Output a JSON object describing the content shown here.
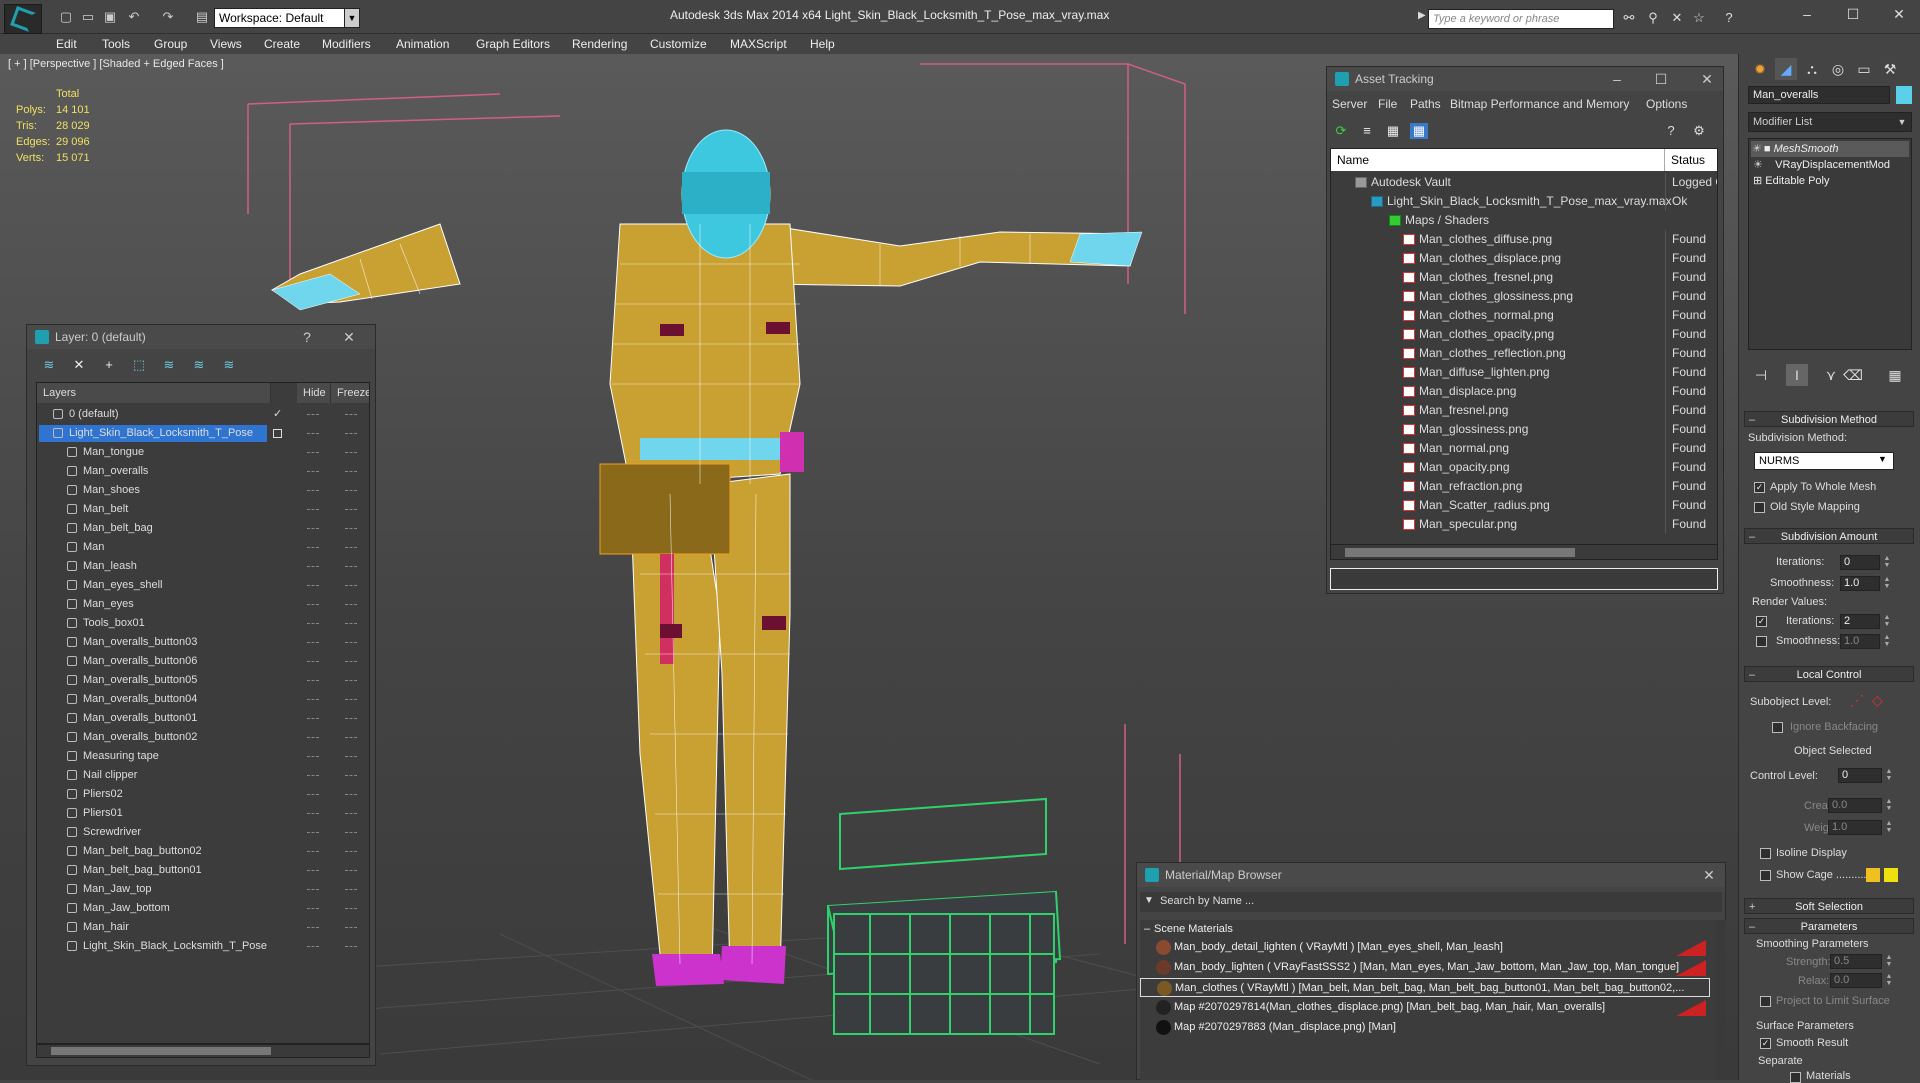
{
  "app": {
    "title": "Autodesk 3ds Max  2014 x64      Light_Skin_Black_Locksmith_T_Pose_max_vray.max",
    "workspace": "Workspace: Default",
    "search_placeholder": "Type a keyword or phrase"
  },
  "menu": [
    "Edit",
    "Tools",
    "Group",
    "Views",
    "Create",
    "Modifiers",
    "Animation",
    "Graph Editors",
    "Rendering",
    "Customize",
    "MAXScript",
    "Help"
  ],
  "viewport": {
    "label": "[ + ] [Perspective ] [Shaded + Edged Faces ]",
    "stats": {
      "header": "Total",
      "polys_label": "Polys:",
      "polys": "14 101",
      "tris_label": "Tris:",
      "tris": "28 029",
      "edges_label": "Edges:",
      "edges": "29 096",
      "verts_label": "Verts:",
      "verts": "15 071"
    }
  },
  "layers": {
    "title": "Layer: 0 (default)",
    "help": "?",
    "col_layers": "Layers",
    "col_hide": "Hide",
    "col_freeze": "Freeze",
    "rows": [
      {
        "name": "0 (default)",
        "level": 1,
        "checked": true
      },
      {
        "name": "Light_Skin_Black_Locksmith_T_Pose",
        "level": 1,
        "selected": true
      },
      {
        "name": "Man_tongue",
        "level": 2
      },
      {
        "name": "Man_overalls",
        "level": 2
      },
      {
        "name": "Man_shoes",
        "level": 2
      },
      {
        "name": "Man_belt",
        "level": 2
      },
      {
        "name": "Man_belt_bag",
        "level": 2
      },
      {
        "name": "Man",
        "level": 2
      },
      {
        "name": "Man_leash",
        "level": 2
      },
      {
        "name": "Man_eyes_shell",
        "level": 2
      },
      {
        "name": "Man_eyes",
        "level": 2
      },
      {
        "name": "Tools_box01",
        "level": 2
      },
      {
        "name": "Man_overalls_button03",
        "level": 2
      },
      {
        "name": "Man_overalls_button06",
        "level": 2
      },
      {
        "name": "Man_overalls_button05",
        "level": 2
      },
      {
        "name": "Man_overalls_button04",
        "level": 2
      },
      {
        "name": "Man_overalls_button01",
        "level": 2
      },
      {
        "name": "Man_overalls_button02",
        "level": 2
      },
      {
        "name": "Measuring tape",
        "level": 2
      },
      {
        "name": "Nail clipper",
        "level": 2
      },
      {
        "name": "Pliers02",
        "level": 2
      },
      {
        "name": "Pliers01",
        "level": 2
      },
      {
        "name": "Screwdriver",
        "level": 2
      },
      {
        "name": "Man_belt_bag_button02",
        "level": 2
      },
      {
        "name": "Man_belt_bag_button01",
        "level": 2
      },
      {
        "name": "Man_Jaw_top",
        "level": 2
      },
      {
        "name": "Man_Jaw_bottom",
        "level": 2
      },
      {
        "name": "Man_hair",
        "level": 2
      },
      {
        "name": "Light_Skin_Black_Locksmith_T_Pose",
        "level": 2
      }
    ]
  },
  "asset_tracking": {
    "title": "Asset Tracking",
    "menu": [
      "Server",
      "File",
      "Paths",
      "Bitmap Performance and Memory",
      "Options"
    ],
    "col_name": "Name",
    "col_status": "Status",
    "rows": [
      {
        "name": "Autodesk Vault",
        "status": "Logged O",
        "level": 0,
        "icon": "vault"
      },
      {
        "name": "Light_Skin_Black_Locksmith_T_Pose_max_vray.max",
        "status": "Ok",
        "level": 1,
        "icon": "max"
      },
      {
        "name": "Maps / Shaders",
        "status": "",
        "level": 2,
        "icon": "maps"
      },
      {
        "name": "Man_clothes_diffuse.png",
        "status": "Found",
        "level": 3,
        "icon": "png"
      },
      {
        "name": "Man_clothes_displace.png",
        "status": "Found",
        "level": 3,
        "icon": "png"
      },
      {
        "name": "Man_clothes_fresnel.png",
        "status": "Found",
        "level": 3,
        "icon": "png"
      },
      {
        "name": "Man_clothes_glossiness.png",
        "status": "Found",
        "level": 3,
        "icon": "png"
      },
      {
        "name": "Man_clothes_normal.png",
        "status": "Found",
        "level": 3,
        "icon": "png"
      },
      {
        "name": "Man_clothes_opacity.png",
        "status": "Found",
        "level": 3,
        "icon": "png"
      },
      {
        "name": "Man_clothes_reflection.png",
        "status": "Found",
        "level": 3,
        "icon": "png"
      },
      {
        "name": "Man_diffuse_lighten.png",
        "status": "Found",
        "level": 3,
        "icon": "png"
      },
      {
        "name": "Man_displace.png",
        "status": "Found",
        "level": 3,
        "icon": "png"
      },
      {
        "name": "Man_fresnel.png",
        "status": "Found",
        "level": 3,
        "icon": "png"
      },
      {
        "name": "Man_glossiness.png",
        "status": "Found",
        "level": 3,
        "icon": "png"
      },
      {
        "name": "Man_normal.png",
        "status": "Found",
        "level": 3,
        "icon": "png"
      },
      {
        "name": "Man_opacity.png",
        "status": "Found",
        "level": 3,
        "icon": "png"
      },
      {
        "name": "Man_refraction.png",
        "status": "Found",
        "level": 3,
        "icon": "png"
      },
      {
        "name": "Man_Scatter_radius.png",
        "status": "Found",
        "level": 3,
        "icon": "png"
      },
      {
        "name": "Man_specular.png",
        "status": "Found",
        "level": 3,
        "icon": "png"
      }
    ]
  },
  "material_browser": {
    "title": "Material/Map Browser",
    "search_placeholder": "Search by Name ...",
    "group": "Scene Materials",
    "rows": [
      {
        "text": "Man_body_detail_lighten  ( VRayMtl ) [Man_eyes_shell, Man_leash]",
        "thumb": "#8a4a30",
        "flag": true
      },
      {
        "text": "Man_body_lighten  ( VRayFastSSS2 ) [Man, Man_eyes, Man_Jaw_bottom, Man_Jaw_top, Man_tongue]",
        "thumb": "#6b3a2a",
        "flag": true
      },
      {
        "text": "Man_clothes  ( VRayMtl ) [Man_belt, Man_belt_bag, Man_belt_bag_button01, Man_belt_bag_button02,...",
        "thumb": "#7a5a20",
        "flag": false,
        "selected": true
      },
      {
        "text": "Map #2070297814(Man_clothes_displace.png)  [Man_belt_bag, Man_hair, Man_overalls]",
        "thumb": "#222222",
        "flag": true
      },
      {
        "text": "Map #2070297883 (Man_displace.png)  [Man]",
        "thumb": "#111111",
        "flag": false
      }
    ]
  },
  "command_panel": {
    "object_name": "Man_overalls",
    "object_color": "#5ad0ea",
    "modifier_list": "Modifier List",
    "stack": [
      "MeshSmooth",
      "VRayDisplacementMod",
      "Editable Poly"
    ],
    "subdiv_method_hdr": "Subdivision Method",
    "subdiv_method_label": "Subdivision Method:",
    "subdiv_method_value": "NURMS",
    "apply_whole_mesh": "Apply To Whole Mesh",
    "old_style_mapping": "Old Style Mapping",
    "subdiv_amount_hdr": "Subdivision Amount",
    "iterations_label": "Iterations:",
    "iterations": "0",
    "smoothness_label": "Smoothness:",
    "smoothness": "1.0",
    "render_values": "Render Values:",
    "r_iterations_label": "Iterations:",
    "r_iterations": "2",
    "r_smoothness_label": "Smoothness:",
    "r_smoothness": "1.0",
    "local_control_hdr": "Local Control",
    "subobject_level": "Subobject Level:",
    "ignore_backfacing": "Ignore Backfacing",
    "object_selected": "Object Selected",
    "control_level_label": "Control Level:",
    "control_level": "0",
    "crease_label": "Crease:",
    "crease": "0.0",
    "weight_label": "Weight:",
    "weight": "1.0",
    "isoline_display": "Isoline Display",
    "show_cage": "Show Cage ..........",
    "soft_selection_hdr": "Soft Selection",
    "parameters_hdr": "Parameters",
    "smoothing_params": "Smoothing Parameters",
    "strength_label": "Strength:",
    "strength": "0.5",
    "relax_label": "Relax:",
    "relax": "0.0",
    "project_limit": "Project to Limit Surface",
    "surface_params": "Surface Parameters",
    "smooth_result": "Smooth Result",
    "separate": "Separate",
    "materials": "Materials"
  }
}
